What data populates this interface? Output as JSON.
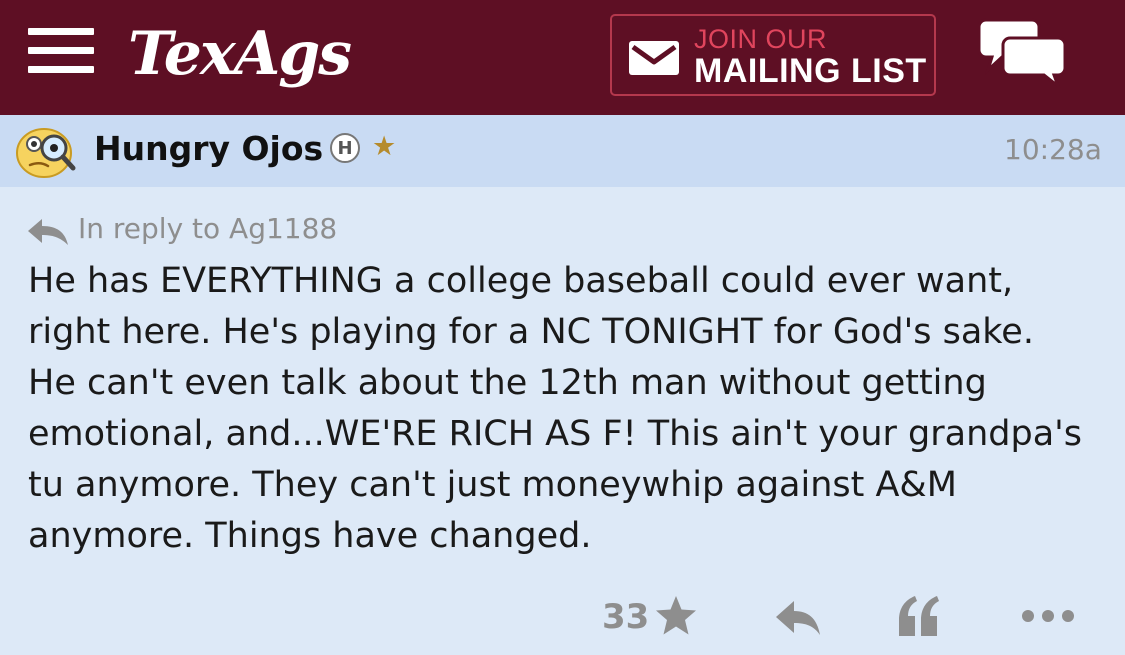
{
  "header": {
    "logo_text": "TexAgs",
    "mailing_line1": "JOIN OUR",
    "mailing_line2": "MAILING LIST",
    "icons": [
      "menu-icon",
      "mail-icon",
      "chat-icon"
    ]
  },
  "post": {
    "username": "Hungry Ojos",
    "badge_letter": "H",
    "badge_star": "★",
    "timestamp": "10:28a",
    "reply_to": "In reply to Ag1188",
    "lines": [
      "He has EVERYTHING a college baseball could ever want,",
      "right here. He's playing for a NC TONIGHT for God's sake.",
      "He can't even talk about the 12th man without getting",
      "emotional, and...WE'RE RICH AS F! This ain't your grandpa's",
      "tu anymore. They can't just moneywhip against A&M",
      "anymore. Things have changed."
    ],
    "likes": "33",
    "action_icons": [
      "star-icon",
      "reply-icon",
      "quote-icon",
      "more-icon"
    ]
  },
  "colors": {
    "header_bg": "#5e0f24",
    "post_header_bg": "#c9dbf3",
    "post_body_bg": "#dde9f7",
    "accent_red": "#e0455d",
    "muted_text": "#8e8e8e"
  }
}
